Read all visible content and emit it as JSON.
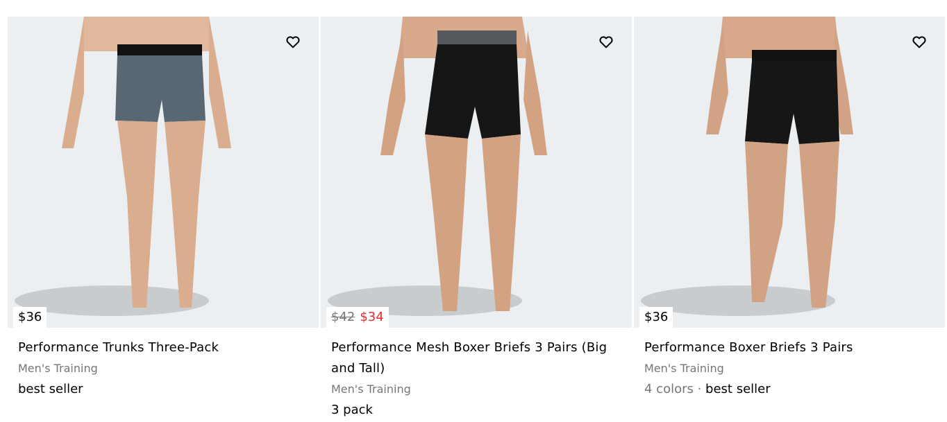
{
  "products": [
    {
      "price": "$36",
      "title": "Performance Trunks Three-Pack",
      "category": "Men's Training",
      "tag": "best seller",
      "colors": "#596774"
    },
    {
      "old_price": "$42",
      "sale_price": "$34",
      "title": "Performance Mesh Boxer Briefs 3 Pairs (Big and Tall)",
      "category": "Men's Training",
      "tag": "3 pack",
      "colors": "#161616"
    },
    {
      "price": "$36",
      "title": "Performance Boxer Briefs 3 Pairs",
      "category": "Men's Training",
      "color_count": "4 colors",
      "separator": " · ",
      "tag": "best seller",
      "colors": "#161616"
    }
  ],
  "theme": {
    "sale_color": "#e32b2b",
    "muted_text": "#767677",
    "image_bg": "#eceff1"
  },
  "icons": {
    "wishlist": "heart-icon"
  }
}
